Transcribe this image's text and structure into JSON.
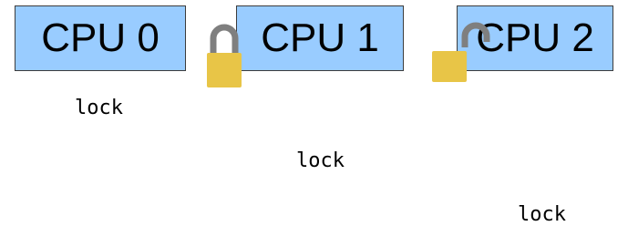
{
  "diagram": {
    "cpus": [
      {
        "label": "CPU 0",
        "lock_text": "lock",
        "lock_state": "none"
      },
      {
        "label": "CPU 1",
        "lock_text": "lock",
        "lock_state": "closed"
      },
      {
        "label": "CPU 2",
        "lock_text": "lock",
        "lock_state": "open"
      }
    ],
    "colors": {
      "cpu_fill": "#99ccff",
      "cpu_border": "#3c3c3c",
      "lock_body": "#e8c547",
      "lock_shackle": "#7f7f7f"
    },
    "icons": {
      "closed_lock": "lock-closed-icon",
      "open_lock": "lock-open-icon"
    }
  }
}
